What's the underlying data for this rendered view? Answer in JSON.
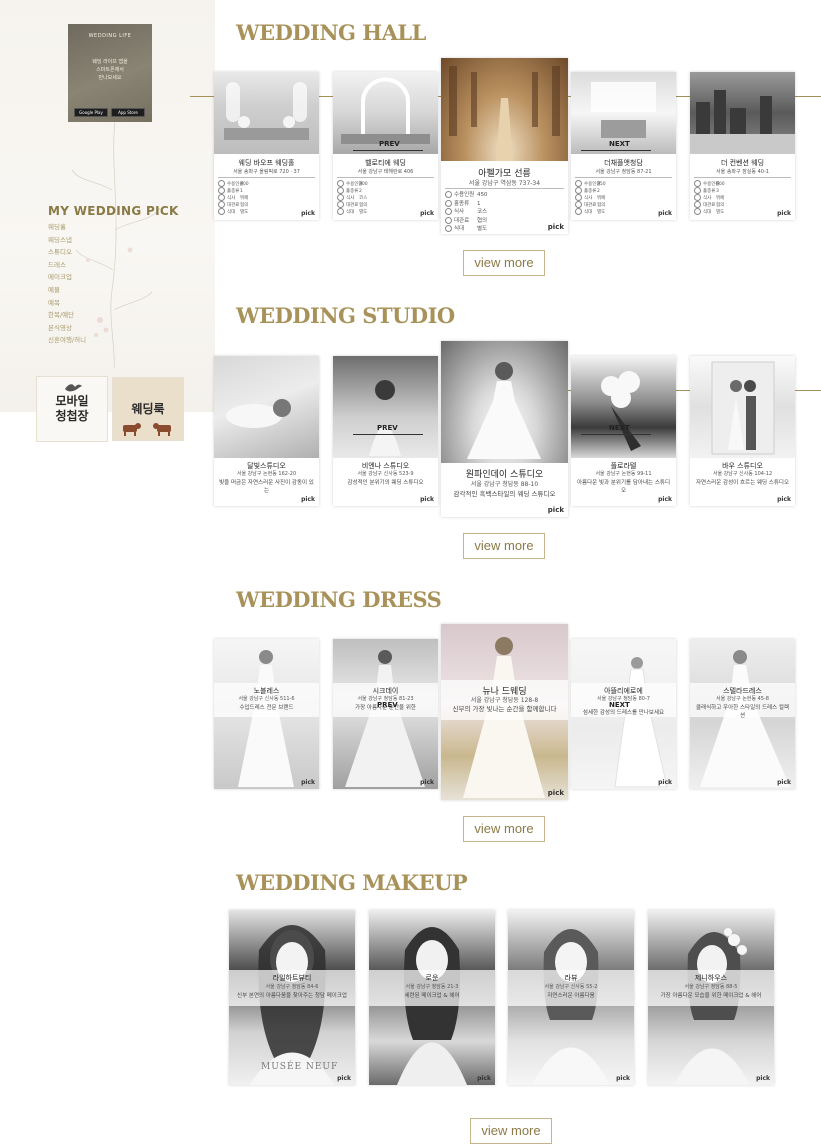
{
  "sidebar": {
    "app_banner": {
      "logo": "WEDDING LIFE",
      "lines": [
        "웨딩 라이프 앱을",
        "스마트폰에서",
        "만나보세요"
      ],
      "google_play": "Google Play",
      "app_store": "App Store"
    },
    "pick_title": "MY WEDDING PICK",
    "menu": [
      "웨딩홀",
      "웨딩스냅",
      "스튜디오",
      "드레스",
      "메이크업",
      "예물",
      "예복",
      "한복/예단",
      "본식영상",
      "신혼여행/허니"
    ],
    "promo_mobile": {
      "line1": "모바일",
      "line2": "청첩장"
    },
    "promo_deal": "웨딩룩"
  },
  "colors": {
    "accent": "#a89259",
    "button_border": "#c6b58a",
    "sidebar_title": "#8a7a45"
  },
  "sections": {
    "hall": {
      "title": "WEDDING HALL",
      "view_more": "view more",
      "prev": "PREV",
      "next": "NEXT",
      "cards": [
        {
          "name": "웨딩 바오프 웨딩홀",
          "addr": "서울 송파구 올림픽로 720 · 37",
          "specs": [
            [
              "수용인원",
              "400"
            ],
            [
              "홀종류",
              "1"
            ],
            [
              "식사",
              "뷔페"
            ],
            [
              "대관료",
              "협의"
            ],
            [
              "식대",
              "별도"
            ]
          ],
          "pick": "pick"
        },
        {
          "name": "벨로티에 웨딩",
          "addr": "서울 강남구 테헤란로 406",
          "specs": [
            [
              "수용인원",
              "300"
            ],
            [
              "홀종류",
              "2"
            ],
            [
              "식사",
              "코스"
            ],
            [
              "대관료",
              "협의"
            ],
            [
              "식대",
              "별도"
            ]
          ],
          "pick": "pick"
        },
        {
          "name": "아펠가모 선릉",
          "addr": "서울 강남구 역삼동 737-34",
          "specs": [
            [
              "수용인원",
              "450"
            ],
            [
              "홀종류",
              "1"
            ],
            [
              "식사",
              "코스"
            ],
            [
              "대관료",
              "협의"
            ],
            [
              "식대",
              "별도"
            ]
          ],
          "pick": "pick"
        },
        {
          "name": "더채플앳청담",
          "addr": "서울 강남구 청담동 87-21",
          "specs": [
            [
              "수용인원",
              "350"
            ],
            [
              "홀종류",
              "2"
            ],
            [
              "식사",
              "뷔페"
            ],
            [
              "대관료",
              "협의"
            ],
            [
              "식대",
              "별도"
            ]
          ],
          "pick": "pick"
        },
        {
          "name": "더 컨벤션 웨딩",
          "addr": "서울 송파구 잠실동 40-1",
          "specs": [
            [
              "수용인원",
              "600"
            ],
            [
              "홀종류",
              "3"
            ],
            [
              "식사",
              "뷔페"
            ],
            [
              "대관료",
              "협의"
            ],
            [
              "식대",
              "별도"
            ]
          ],
          "pick": "pick"
        }
      ]
    },
    "studio": {
      "title": "WEDDING STUDIO",
      "view_more": "view more",
      "prev": "PREV",
      "next": "NEXT",
      "cards": [
        {
          "name": "달빛스튜디오",
          "addr": "서울 강남구 논현동 162-20",
          "desc": "빛을 머금은 자연스러운 사진이 감동이 있는",
          "pick": "pick"
        },
        {
          "name": "비엔나 스튜디오",
          "addr": "서울 강남구 신사동 523-9",
          "desc": "감성적인 분위기의 웨딩 스튜디오",
          "pick": "pick"
        },
        {
          "name": "원파인데이 스튜디오",
          "addr": "서울 강남구 청담동 88-10",
          "desc": "감각적인 흑백스타일의 웨딩 스튜디오",
          "pick": "pick"
        },
        {
          "name": "플로라텔",
          "addr": "서울 강남구 논현동 99-11",
          "desc": "아름다운 빛과 분위기를 담아내는 스튜디오",
          "pick": "pick"
        },
        {
          "name": "바우 스튜디오",
          "addr": "서울 강남구 신사동 104-12",
          "desc": "자연스러운 감성이 흐르는 웨딩 스튜디오",
          "pick": "pick"
        }
      ]
    },
    "dress": {
      "title": "WEDDING DRESS",
      "view_more": "view more",
      "prev": "PREV",
      "next": "NEXT",
      "cards": [
        {
          "name": "노블레스",
          "addr": "서울 강남구 신사동 511-6",
          "desc": "수입드레스 전문 브랜드",
          "pick": "pick"
        },
        {
          "name": "시크데이",
          "addr": "서울 강남구 청담동 81-23",
          "desc": "가장 아름다운 순간을 위한",
          "pick": "pick"
        },
        {
          "name": "뉴나 드웨딩",
          "addr": "서울 강남구 청담동 128-8",
          "desc": "신부의 가장 빛나는 순간을 함께합니다",
          "pick": "pick"
        },
        {
          "name": "아뜰리에로에",
          "addr": "서울 강남구 청담동 80-7",
          "desc": "섬세한 감성의 드레스를 만나보세요",
          "pick": "pick"
        },
        {
          "name": "스텔라드레스",
          "addr": "서울 강남구 논현동 45-8",
          "desc": "클래식하고 우아한 스타일의 드레스 컬렉션",
          "pick": "pick"
        }
      ]
    },
    "makeup": {
      "title": "WEDDING MAKEUP",
      "view_more": "view more",
      "cards": [
        {
          "name": "라일하트뷰티",
          "addr": "서울 강남구 청담동 84-6",
          "desc": "신부 본연의 아름다움을 찾아주는 청담 메이크업",
          "logo": "MUSÉE NEUF",
          "pick": "pick"
        },
        {
          "name": "로운",
          "addr": "서울 강남구 청담동 21-3",
          "desc": "세련된 메이크업 & 헤어",
          "pick": "pick"
        },
        {
          "name": "라뷰",
          "addr": "서울 강남구 신사동 55-2",
          "desc": "자연스러운 아름다움",
          "pick": "pick"
        },
        {
          "name": "제니하우스",
          "addr": "서울 강남구 청담동 88-5",
          "desc": "가장 아름다운 모습을 위한 메이크업 & 헤어",
          "pick": "pick"
        }
      ]
    }
  }
}
